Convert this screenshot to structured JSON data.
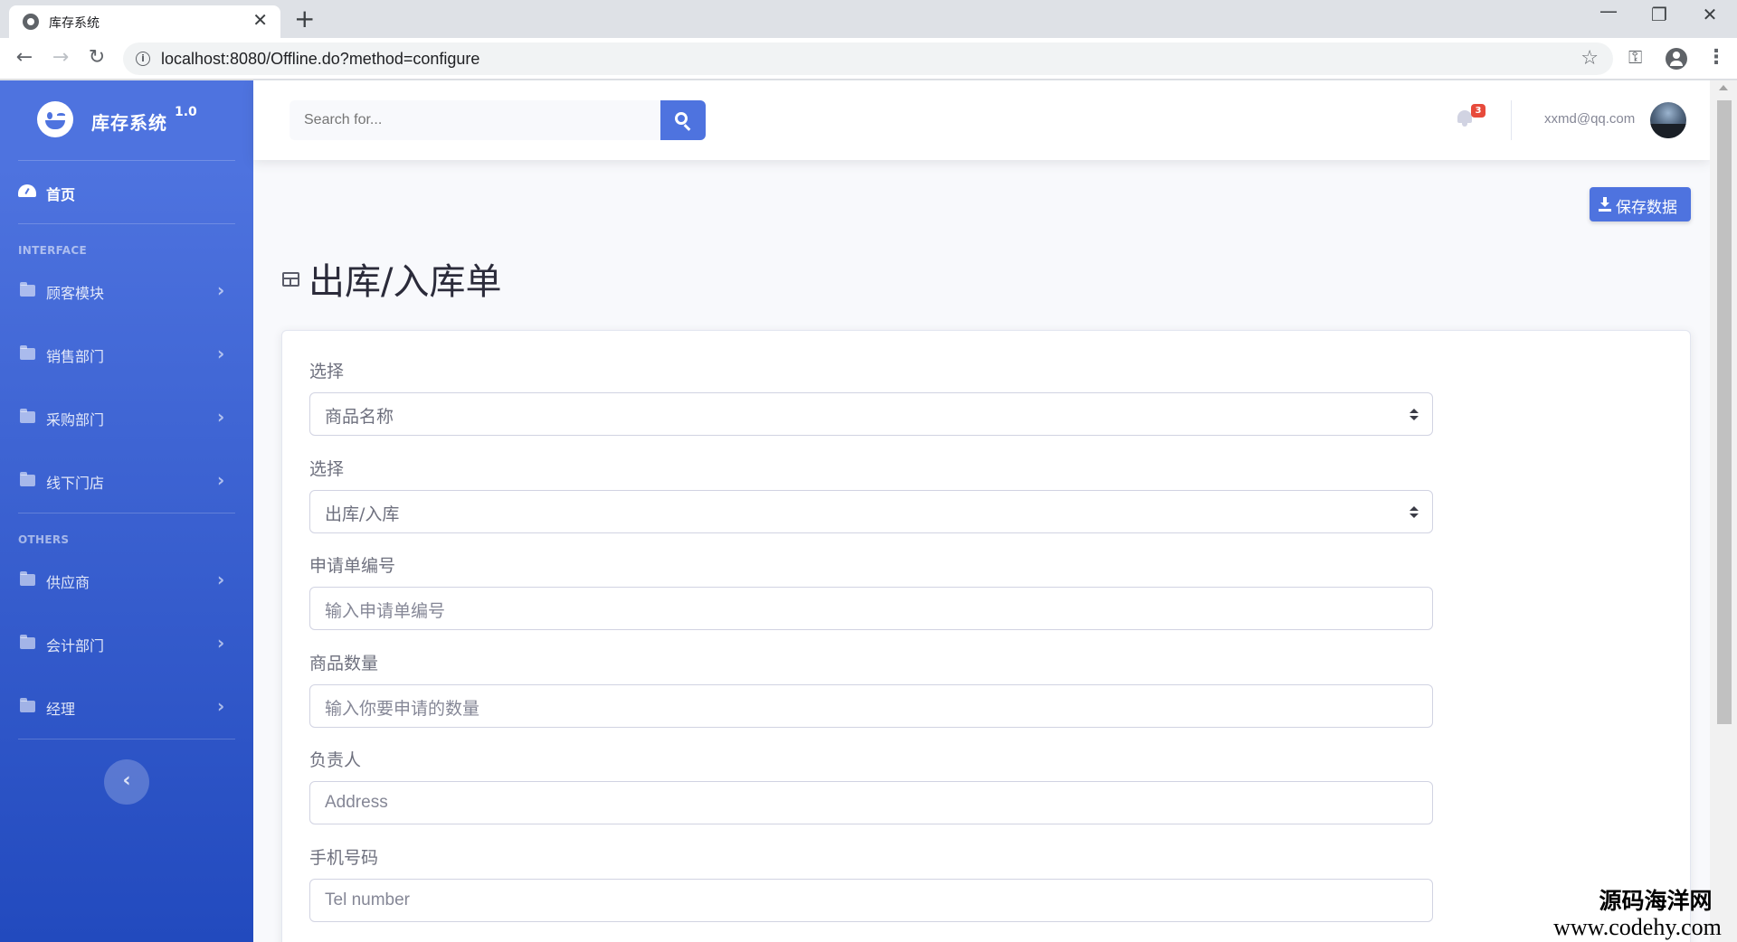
{
  "browser": {
    "tab_title": "库存系统",
    "tab_close": "✕",
    "new_tab": "+",
    "url": "localhost:8080/Offline.do?method=configure",
    "info_icon_text": "i",
    "window_minimize": "—",
    "window_restore": "❐",
    "window_close": "✕"
  },
  "sidebar": {
    "brand_name": "库存系统",
    "brand_version": "1.0",
    "home_label": "首页",
    "heading_interface": "INTERFACE",
    "heading_others": "OTHERS",
    "items": [
      {
        "label": "顾客模块"
      },
      {
        "label": "销售部门"
      },
      {
        "label": "采购部门"
      },
      {
        "label": "线下门店"
      },
      {
        "label": "供应商"
      },
      {
        "label": "会计部门"
      },
      {
        "label": "经理"
      }
    ],
    "toggle_glyph": "‹"
  },
  "topbar": {
    "search_placeholder": "Search for...",
    "notification_count": "3",
    "user_email": "xxmd@qq.com"
  },
  "main": {
    "save_button_label": "保存数据",
    "page_title": "出库/入库单",
    "form": {
      "select1_label": "选择",
      "select1_value": "商品名称",
      "select2_label": "选择",
      "select2_value": "出库/入库",
      "request_no_label": "申请单编号",
      "request_no_placeholder": "输入申请单编号",
      "quantity_label": "商品数量",
      "quantity_placeholder": "输入你要申请的数量",
      "owner_label": "负责人",
      "owner_placeholder": "Address",
      "phone_label": "手机号码",
      "phone_placeholder": "Tel number"
    }
  },
  "watermark": {
    "line1": "源码海洋网",
    "line2": "www.codehy.com"
  },
  "colors": {
    "primary": "#4e73df",
    "sidebar_gradient_end": "#224abe",
    "badge": "#e74a3b"
  }
}
